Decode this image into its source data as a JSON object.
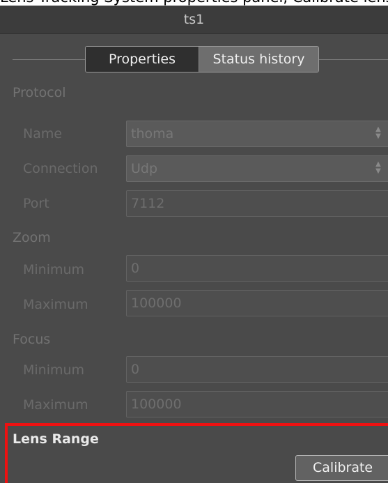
{
  "caption": "Lens Tracking System properties panel, Calibrate lens range",
  "panel": {
    "title": "ts1",
    "tabs": [
      {
        "label": "Properties",
        "active": true
      },
      {
        "label": "Status history",
        "active": false
      }
    ]
  },
  "protocol": {
    "heading": "Protocol",
    "name": {
      "label": "Name",
      "value": "thoma"
    },
    "connection": {
      "label": "Connection",
      "value": "Udp"
    },
    "port": {
      "label": "Port",
      "value": "7112"
    }
  },
  "zoom": {
    "heading": "Zoom",
    "minimum": {
      "label": "Minimum",
      "value": "0"
    },
    "maximum": {
      "label": "Maximum",
      "value": "100000"
    }
  },
  "focus": {
    "heading": "Focus",
    "minimum": {
      "label": "Minimum",
      "value": "0"
    },
    "maximum": {
      "label": "Maximum",
      "value": "100000"
    }
  },
  "lens_range": {
    "heading": "Lens Range",
    "calibrate_label": "Calibrate"
  },
  "colors": {
    "panel_background": "#4a4a4a",
    "titlebar_background": "#3c3c3c",
    "highlight_border": "#ee1111"
  }
}
